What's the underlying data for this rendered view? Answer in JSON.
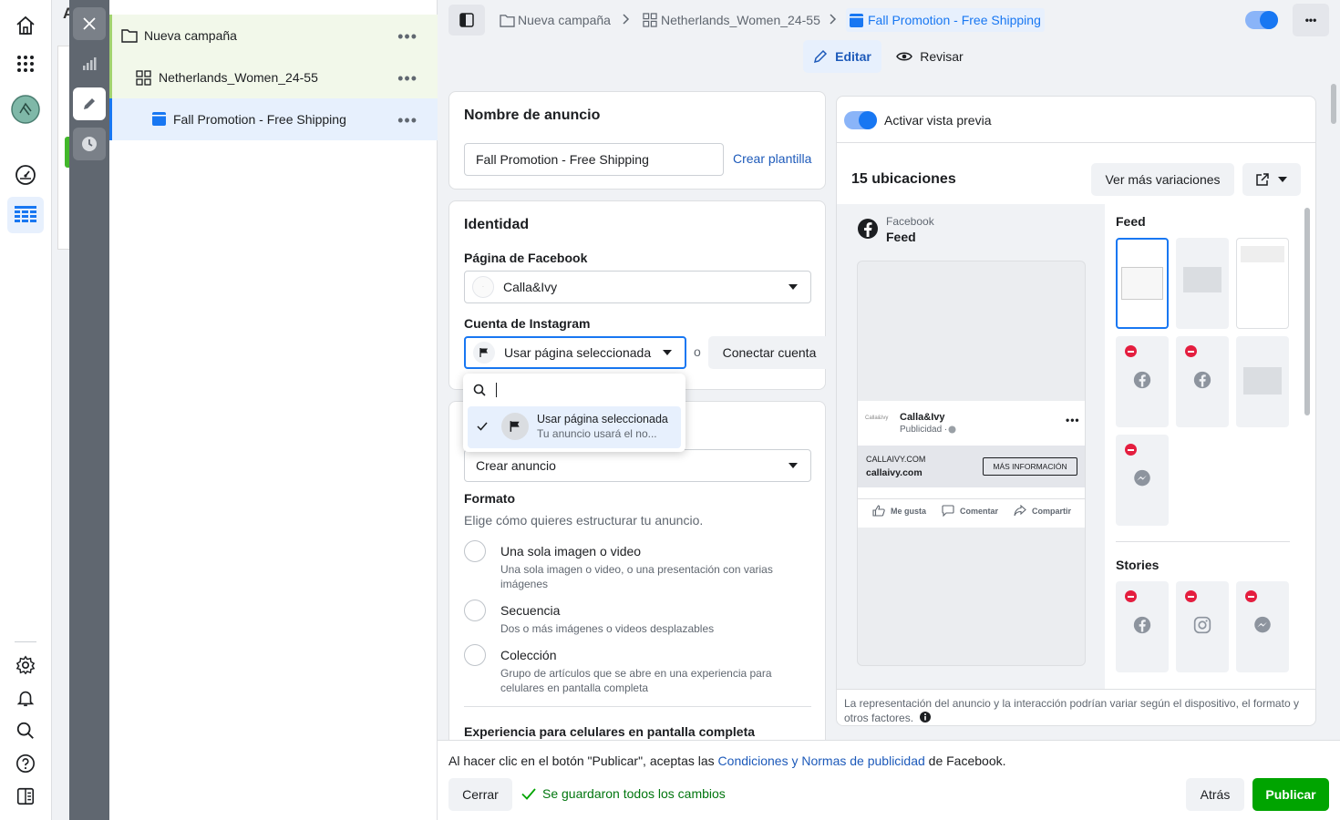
{
  "tree": {
    "campaign": "Nueva campaña",
    "adset": "Netherlands_Women_24-55",
    "ad": "Fall Promotion - Free Shipping",
    "more": "•••"
  },
  "under_char": "A",
  "breadcrumb": {
    "campaign": "Nueva campaña",
    "adset": "Netherlands_Women_24-55",
    "ad": "Fall Promotion - Free Shipping",
    "more": "•••"
  },
  "modes": {
    "edit": "Editar",
    "review": "Revisar"
  },
  "ad_name": {
    "title": "Nombre de anuncio",
    "value": "Fall Promotion - Free Shipping",
    "template_link": "Crear plantilla"
  },
  "identity": {
    "title": "Identidad",
    "fb_label": "Página de Facebook",
    "fb_value": "Calla&Ivy",
    "ig_label": "Cuenta de Instagram",
    "ig_value": "Usar página seleccionada",
    "or": "o",
    "connect": "Conectar cuenta"
  },
  "dropdown": {
    "item_title": "Usar página seleccionada",
    "item_sub": "Tu anuncio usará el no..."
  },
  "creative": {
    "select_value": "Crear anuncio",
    "format_label": "Formato",
    "format_help": "Elige cómo quieres estructurar tu anuncio.",
    "options": [
      {
        "title": "Una sola imagen o video",
        "desc": "Una sola imagen o video, o una presentación con varias imágenes"
      },
      {
        "title": "Secuencia",
        "desc": "Dos o más imágenes o videos desplazables"
      },
      {
        "title": "Colección",
        "desc": "Grupo de artículos que se abre en una experiencia para celulares en pantalla completa"
      }
    ],
    "fullscreen_label": "Experiencia para celulares en pantalla completa"
  },
  "preview": {
    "toggle_label": "Activar vista previa",
    "placements": "15 ubicaciones",
    "more_variations": "Ver más variaciones",
    "platform": "Facebook",
    "placement": "Feed",
    "page_name": "Calla&Ivy",
    "sponsored": "Publicidad · ",
    "domain_upper": "CALLAIVY.COM",
    "domain": "callaivy.com",
    "cta": "MÁS INFORMACIÓN",
    "like": "Me gusta",
    "comment": "Comentar",
    "share": "Compartir",
    "feed_label": "Feed",
    "stories_label": "Stories",
    "disclaimer": "La representación del anuncio y la interacción podrían variar según el dispositivo, el formato y otros factores."
  },
  "footer": {
    "terms_pre": "Al hacer clic en el botón \"Publicar\", aceptas las ",
    "terms_link": "Condiciones y Normas de publicidad",
    "terms_post": " de Facebook.",
    "close": "Cerrar",
    "saved": "Se guardaron todos los cambios",
    "back": "Atrás",
    "publish": "Publicar"
  },
  "colors": {
    "accent": "#1877f2",
    "publish": "#00a400",
    "dark_rail": "#606770"
  }
}
